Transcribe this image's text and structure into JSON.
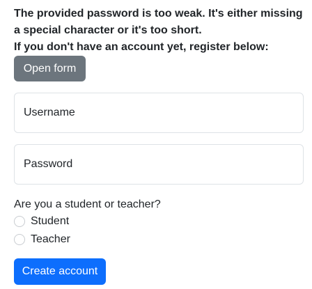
{
  "error": {
    "line1": "The provided password is too weak. It's either missing",
    "line2": "a special character or it's too short.",
    "line3": "If you don't have an account yet, register below:"
  },
  "open_form_button": {
    "label": "Open form"
  },
  "form": {
    "username": {
      "placeholder": "Username",
      "value": ""
    },
    "password": {
      "placeholder": "Password",
      "value": ""
    },
    "role_question": "Are you a student or teacher?",
    "roles": [
      {
        "label": "Student",
        "selected": false
      },
      {
        "label": "Teacher",
        "selected": false
      }
    ],
    "submit_label": "Create account"
  },
  "colors": {
    "secondary_button": "#6c757d",
    "primary_button": "#0d6efd",
    "input_border": "#dee2e6",
    "text": "#212529"
  }
}
